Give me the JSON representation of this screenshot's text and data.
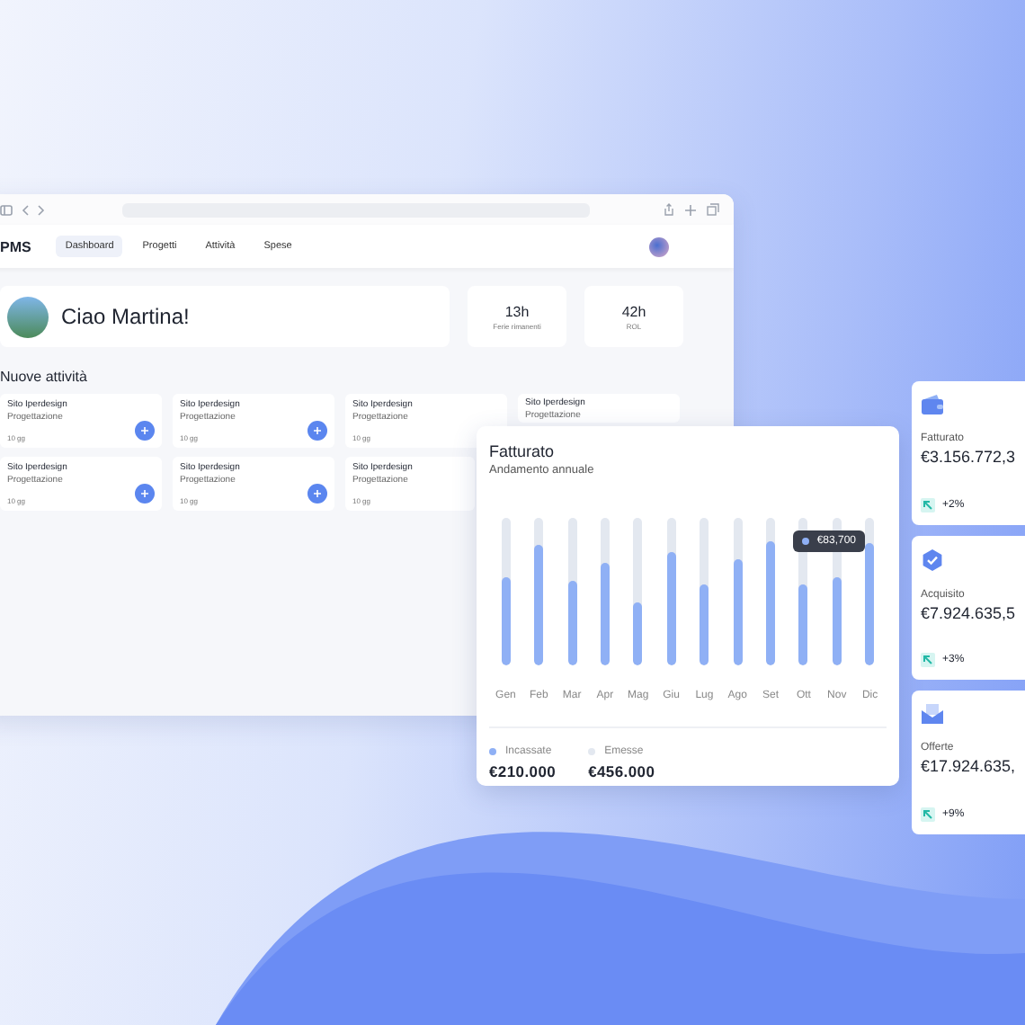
{
  "browser": {
    "logo": "PMS",
    "tabs": [
      {
        "label": "Dashboard",
        "selected": true
      },
      {
        "label": "Progetti",
        "selected": false
      },
      {
        "label": "Attività",
        "selected": false
      },
      {
        "label": "Spese",
        "selected": false
      }
    ],
    "greeting": "Ciao Martina!",
    "stats": [
      {
        "value": "13h",
        "label": "Ferie rimanenti"
      },
      {
        "value": "42h",
        "label": "ROL"
      }
    ],
    "section_title": "Nuove attività",
    "cards": [
      {
        "title": "Sito Iperdesign",
        "subtitle": "Progettazione",
        "days": "10 gg",
        "add": true
      },
      {
        "title": "Sito Iperdesign",
        "subtitle": "Progettazione",
        "days": "10 gg",
        "add": true
      },
      {
        "title": "Sito Iperdesign",
        "subtitle": "Progettazione",
        "days": "10 gg",
        "add": false
      },
      {
        "title": "Sito Iperdesign",
        "subtitle": "Progettazione",
        "add": false
      },
      {
        "title": "Sito Iperdesign",
        "subtitle": "Progettazione",
        "days": "10 gg",
        "add": true
      },
      {
        "title": "Sito Iperdesign",
        "subtitle": "Progettazione",
        "days": "10 gg",
        "add": true
      },
      {
        "title": "Sito Iperdesign",
        "subtitle": "Progettazione",
        "days": "10 gg",
        "add": false
      }
    ]
  },
  "revenue_chart": {
    "title": "Fatturato",
    "subtitle": "Andamento annuale",
    "months": [
      {
        "label": "Gen"
      },
      {
        "label": "Feb"
      },
      {
        "label": "Mar"
      },
      {
        "label": "Apr"
      },
      {
        "label": "Mag"
      },
      {
        "label": "Giu"
      },
      {
        "label": "Lug"
      },
      {
        "label": "Ago"
      },
      {
        "label": "Set",
        "tooltip": "€83,700"
      },
      {
        "label": "Ott"
      },
      {
        "label": "Nov"
      },
      {
        "label": "Dic"
      }
    ],
    "legend": [
      {
        "label": "Incassate",
        "value": "€210.000",
        "color": "#8fb0f5"
      },
      {
        "label": "Emesse",
        "value": "€456.000",
        "color": "#e3e8f0"
      }
    ]
  },
  "kpis": [
    {
      "kind": "wallet",
      "title": "Fatturato",
      "value": "€3.156.772,3",
      "change": "+2%"
    },
    {
      "kind": "badge",
      "title": "Acquisito",
      "value": "€7.924.635,5",
      "change": "+3%"
    },
    {
      "kind": "envelope",
      "title": "Offerte",
      "value": "€17.924.635,",
      "change": "+9%"
    }
  ]
}
